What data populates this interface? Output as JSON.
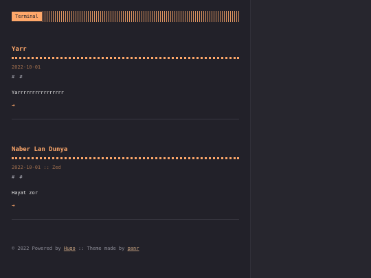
{
  "header": {
    "logo": "Terminal"
  },
  "posts": [
    {
      "title": "Yarr",
      "date": "2022-10-01",
      "author": "",
      "tags": "# #",
      "content": "Yarrrrrrrrrrrrrrrr",
      "read_more": "➔"
    },
    {
      "title": "Naber Lan Dunya",
      "date": "2022-10-01",
      "author": ":: Zed",
      "tags": "# #",
      "content": "Hayat zor",
      "read_more": "➔"
    }
  ],
  "footer": {
    "copyright": "© 2022 Powered by ",
    "hugo_link": "Hugo",
    "theme_text": " :: Theme made by ",
    "author_link": "panr"
  }
}
